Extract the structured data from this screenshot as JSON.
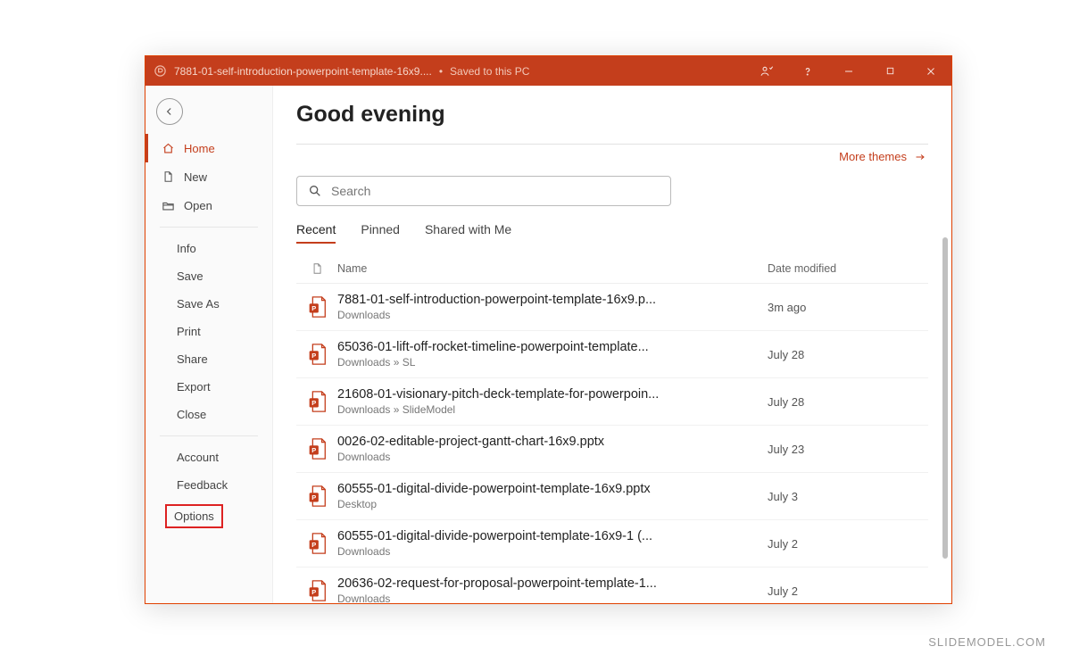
{
  "titlebar": {
    "document": "7881-01-self-introduction-powerpoint-template-16x9....",
    "saved": "Saved to this PC"
  },
  "sidebar": {
    "home": "Home",
    "new": "New",
    "open": "Open",
    "info": "Info",
    "save": "Save",
    "save_as": "Save As",
    "print": "Print",
    "share": "Share",
    "export": "Export",
    "close": "Close",
    "account": "Account",
    "feedback": "Feedback",
    "options": "Options"
  },
  "main": {
    "greeting": "Good evening",
    "more_themes": "More themes",
    "search_placeholder": "Search",
    "tabs": {
      "recent": "Recent",
      "pinned": "Pinned",
      "shared": "Shared with Me"
    },
    "columns": {
      "name": "Name",
      "date": "Date modified"
    },
    "files": [
      {
        "name": "7881-01-self-introduction-powerpoint-template-16x9.p...",
        "location": "Downloads",
        "date": "3m ago"
      },
      {
        "name": "65036-01-lift-off-rocket-timeline-powerpoint-template...",
        "location": "Downloads » SL",
        "date": "July 28"
      },
      {
        "name": "21608-01-visionary-pitch-deck-template-for-powerpoin...",
        "location": "Downloads » SlideModel",
        "date": "July 28"
      },
      {
        "name": "0026-02-editable-project-gantt-chart-16x9.pptx",
        "location": "Downloads",
        "date": "July 23"
      },
      {
        "name": "60555-01-digital-divide-powerpoint-template-16x9.pptx",
        "location": "Desktop",
        "date": "July 3"
      },
      {
        "name": "60555-01-digital-divide-powerpoint-template-16x9-1 (...",
        "location": "Downloads",
        "date": "July 2"
      },
      {
        "name": "20636-02-request-for-proposal-powerpoint-template-1...",
        "location": "Downloads",
        "date": "July 2"
      }
    ]
  },
  "footer": "SLIDEMODEL.COM"
}
